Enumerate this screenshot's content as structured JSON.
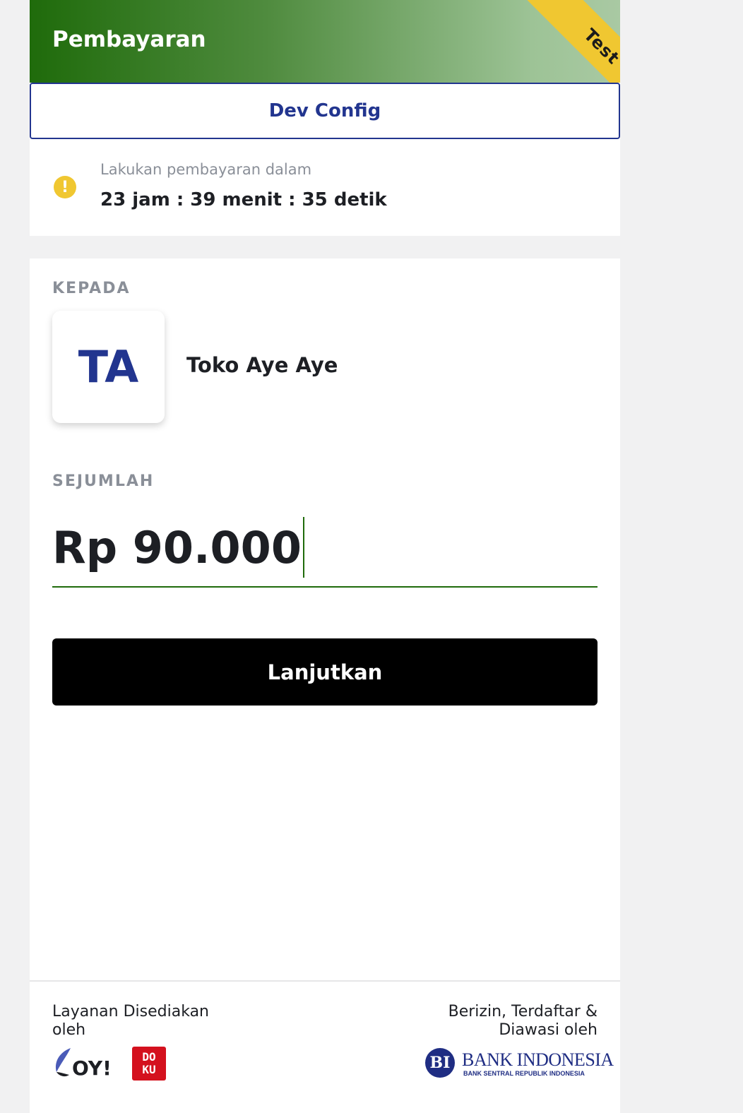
{
  "header": {
    "title": "Pembayaran",
    "ribbon": "Test",
    "gradient_colors": [
      "#1f6b0b",
      "#a9c9a3"
    ]
  },
  "dev_config": {
    "label": "Dev Config"
  },
  "countdown": {
    "label": "Lakukan pembayaran dalam",
    "time": "23 jam : 39 menit : 35 detik",
    "icon": "warning-icon"
  },
  "recipient": {
    "section_label": "KEPADA",
    "initials": "TA",
    "name": "Toko Aye Aye"
  },
  "amount": {
    "section_label": "SEJUMLAH",
    "value": "Rp 90.000"
  },
  "actions": {
    "continue_label": "Lanjutkan"
  },
  "footer": {
    "provider_label": "Layanan Disediakan oleh",
    "regulator_label": "Berizin, Terdaftar & Diawasi oleh",
    "oy_logo_text": "OY!",
    "doku_logo_top": "DO",
    "doku_logo_bottom": "KU",
    "bi_name": "BANK INDONESIA",
    "bi_sub": "BANK SENTRAL REPUBLIK INDONESIA",
    "bi_emblem": "BI"
  },
  "colors": {
    "brand_green": "#1f6b0b",
    "accent_blue": "#22358f",
    "ribbon_yellow": "#f0c731",
    "doku_red": "#d4111e"
  }
}
